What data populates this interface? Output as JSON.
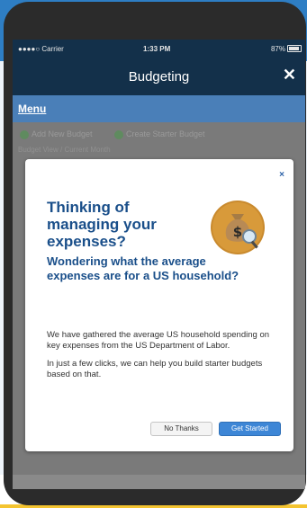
{
  "status_bar": {
    "carrier": "●●●●○ Carrier",
    "time": "1:33 PM",
    "battery": "87%"
  },
  "nav": {
    "title": "Budgeting",
    "close": "✕"
  },
  "menu": {
    "label": "Menu"
  },
  "dimmed": {
    "add_new_budget": "Add New Budget",
    "create_starter_budget": "Create Starter Budget",
    "budget_view": "Budget View / Current Month"
  },
  "modal": {
    "close": "×",
    "heading": "Thinking of managing your expenses?",
    "subheading": "Wondering what the average expenses are for a US household?",
    "body_1": "We have gathered the average US household spending on key expenses from the US Department of Labor.",
    "body_2": "In just a few clicks, we can help you build starter budgets based on that.",
    "no_thanks": "No Thanks",
    "get_started": "Get Started"
  },
  "bottom": {
    "d1": "$",
    "d2": "$",
    "d3": "$"
  },
  "colors": {
    "brand_blue": "#2e7ec4",
    "nav_dark": "#13304a",
    "heading_blue": "#1a4f8a",
    "primary_button": "#3d86d6"
  }
}
